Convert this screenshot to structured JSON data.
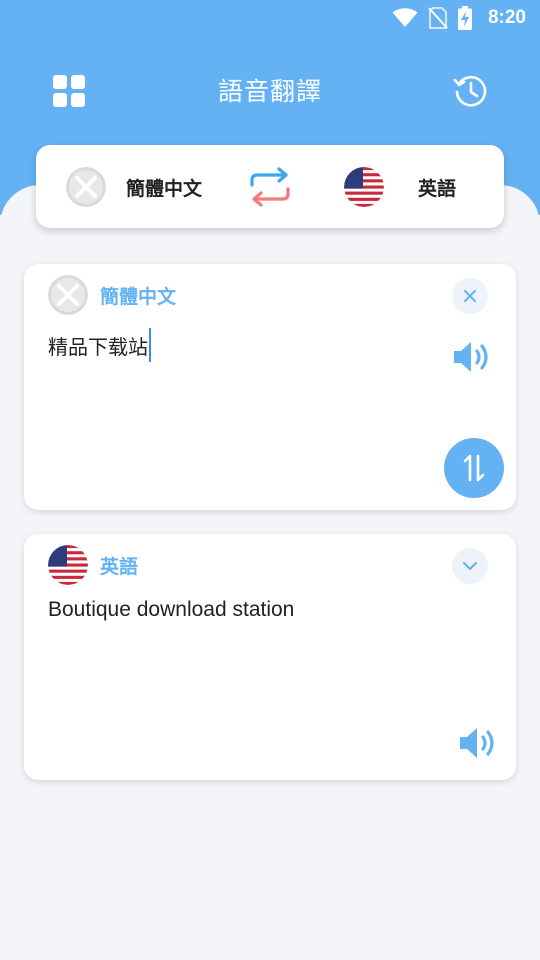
{
  "status_bar": {
    "time": "8:20"
  },
  "app_bar": {
    "title": "語音翻譯"
  },
  "language_selector": {
    "source_language": "簡體中文",
    "target_language": "英語"
  },
  "source_card": {
    "language": "簡體中文",
    "text": "精品下载站"
  },
  "target_card": {
    "language": "英語",
    "text": "Boutique download station"
  },
  "colors": {
    "primary": "#64b2f4",
    "swap_top": "#3fa4f2",
    "swap_bottom": "#f27a7a",
    "background": "#f3f5f9"
  }
}
